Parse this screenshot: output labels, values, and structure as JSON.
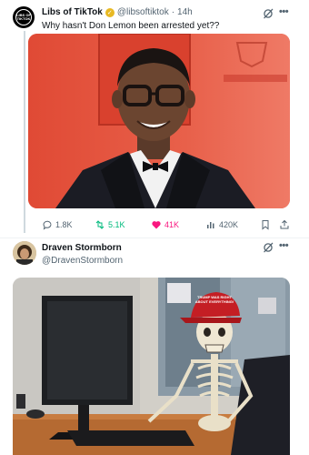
{
  "post1": {
    "author_name": "Libs of TikTok",
    "handle": "@libsoftiktok",
    "separator": "·",
    "time": "14h",
    "text": "Why hasn't Don Lemon been arrested yet??",
    "avatar_text": "LIBS OF TIKTOK",
    "verified_badge_color": "#e8b923",
    "actions": {
      "replies": "1.8K",
      "reposts": "5.1K",
      "likes": "41K",
      "views": "420K"
    }
  },
  "post2": {
    "author_name": "Draven Stormborn",
    "handle": "@DravenStormborn",
    "hat_text": "TRUMP WAS RIGHT ABOUT EVERYTHING!"
  },
  "colors": {
    "repost_active": "#00ba7c",
    "like_active": "#f91880",
    "muted": "#536471",
    "media1_background": "#e0503a"
  },
  "icons": [
    "grok-icon",
    "more-icon",
    "reply-icon",
    "repost-icon",
    "like-icon",
    "views-icon",
    "bookmark-icon",
    "share-icon",
    "verified-badge-icon"
  ]
}
